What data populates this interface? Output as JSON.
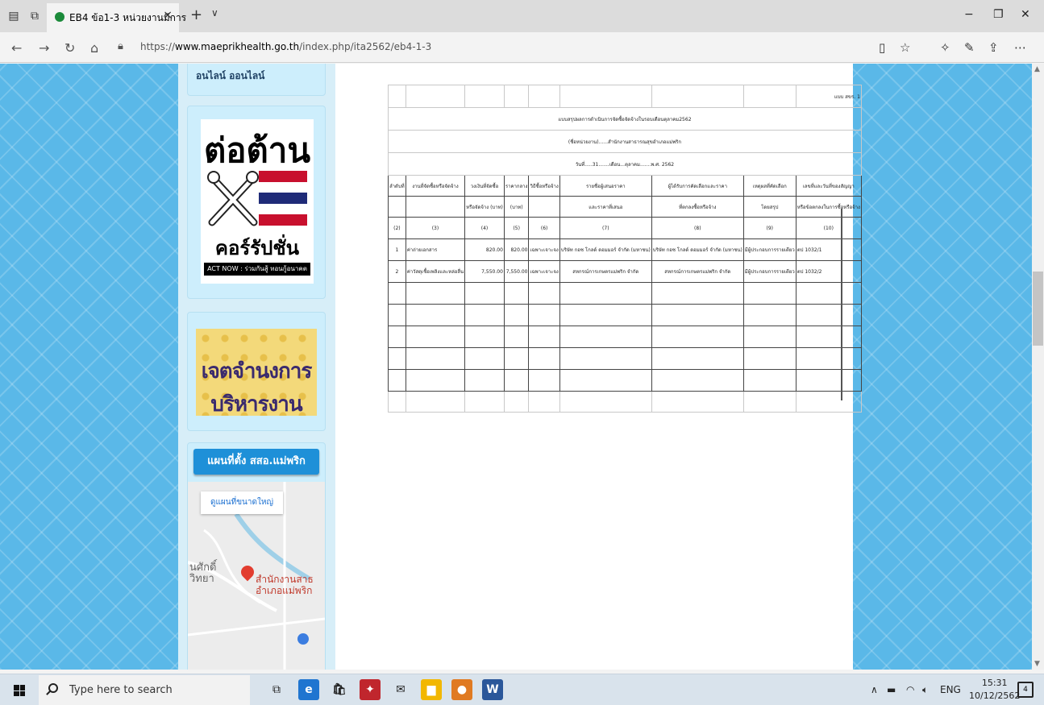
{
  "browser": {
    "tab_title": "EB4 ข้อ1-3 หน่วยงานมีการ",
    "tab_close": "×",
    "new_tab": "+",
    "tab_list": "∨",
    "url_prefix": "https://",
    "url_domain": "www.maeprikhealth.go.th",
    "url_path": "/index.php/ita2562/eb4-1-3",
    "window_controls": {
      "minimize": "−",
      "restore": "❐",
      "close": "✕"
    }
  },
  "sidebar": {
    "online_text": "อนไลน์ ออนไลน์",
    "anticorruption": {
      "title": "ต่อต้าน",
      "corruption": "คอร์รัปชั่น",
      "slogan": "ACT NOW : ร่วมกันสู้ ทอนกู้อนาคต"
    },
    "intent_banner": "เจตจำนงการบริหารงาน",
    "map": {
      "header": "แผนที่ตั้ง สสอ.แม่พริก",
      "enlarge_link": "ดูแผนที่ขนาดใหญ่",
      "place_left": "นศักดิ์\nวิทยา",
      "place_office": "สำนักงานสาธ\nอำเภอแม่พริก"
    }
  },
  "document": {
    "form_code": "แบบ สขร. 1",
    "title": "แบบสรุปผลการดำเนินการจัดซื้อจัดจ้างในรอบเดือนตุลาคม2562",
    "agency": "(ชื่อหน่วยงาน)......สำนักงานสาธารณสุขอำเภอแม่พริก",
    "date": "วันที่.....31.......เดือน...ตุลาคม.......พ.ศ. 2562",
    "headers_row1": [
      "ลำดับที่",
      "งานที่จัดซื้อหรือจัดจ้าง",
      "วงเงินที่จัดซื้อ",
      "ราคากลาง",
      "วิธีซื้อหรือจ้าง",
      "รายชื่อผู้เสนอราคา",
      "ผู้ได้รับการคัดเลือกและราคา",
      "เหตุผลที่คัดเลือก",
      "เลขที่และวันที่ของสัญญา"
    ],
    "headers_row2": [
      "",
      "",
      "หรือจัดจ้าง (บาท)",
      "(บาท)",
      "",
      "และราคาที่เสนอ",
      "ที่ตกลงซื้อหรือจ้าง",
      "โดยสรุป",
      "หรือข้อตกลงในการซื้อหรือจ้าง"
    ],
    "col_numbers": [
      "(2)",
      "(3)",
      "(4)",
      "(5)",
      "(6)",
      "(7)",
      "(8)",
      "(9)",
      "(10)"
    ],
    "rows": [
      [
        "1",
        "ค่าถ่ายเอกสาร",
        "820.00",
        "820.00",
        "เฉพาะเจาะจง",
        "บริษัท กอซ โกลด์ ดอมมอร์ จำกัด (มหาชน)",
        "บริษัท กอซ โกลด์ ดอมมอร์ จำกัด (มหาชน)",
        "มีผู้ประกอบการรายเดียว",
        "ตป 1032/1"
      ],
      [
        "2",
        "ค่าวัสดุเชื้อเพลิงและหล่อลื่น",
        "7,550.00",
        "7,550.00",
        "เฉพาะเจาะจง",
        "สหกรณ์การเกษตรแม่พริก จำกัด",
        "สหกรณ์การเกษตรแม่พริก จำกัด",
        "มีผู้ประกอบการรายเดียว",
        "ตป 1032/2"
      ]
    ]
  },
  "taskbar": {
    "search_placeholder": "Type here to search",
    "lang": "ENG",
    "time": "15:31",
    "date": "10/12/2562",
    "notifications": "4"
  }
}
